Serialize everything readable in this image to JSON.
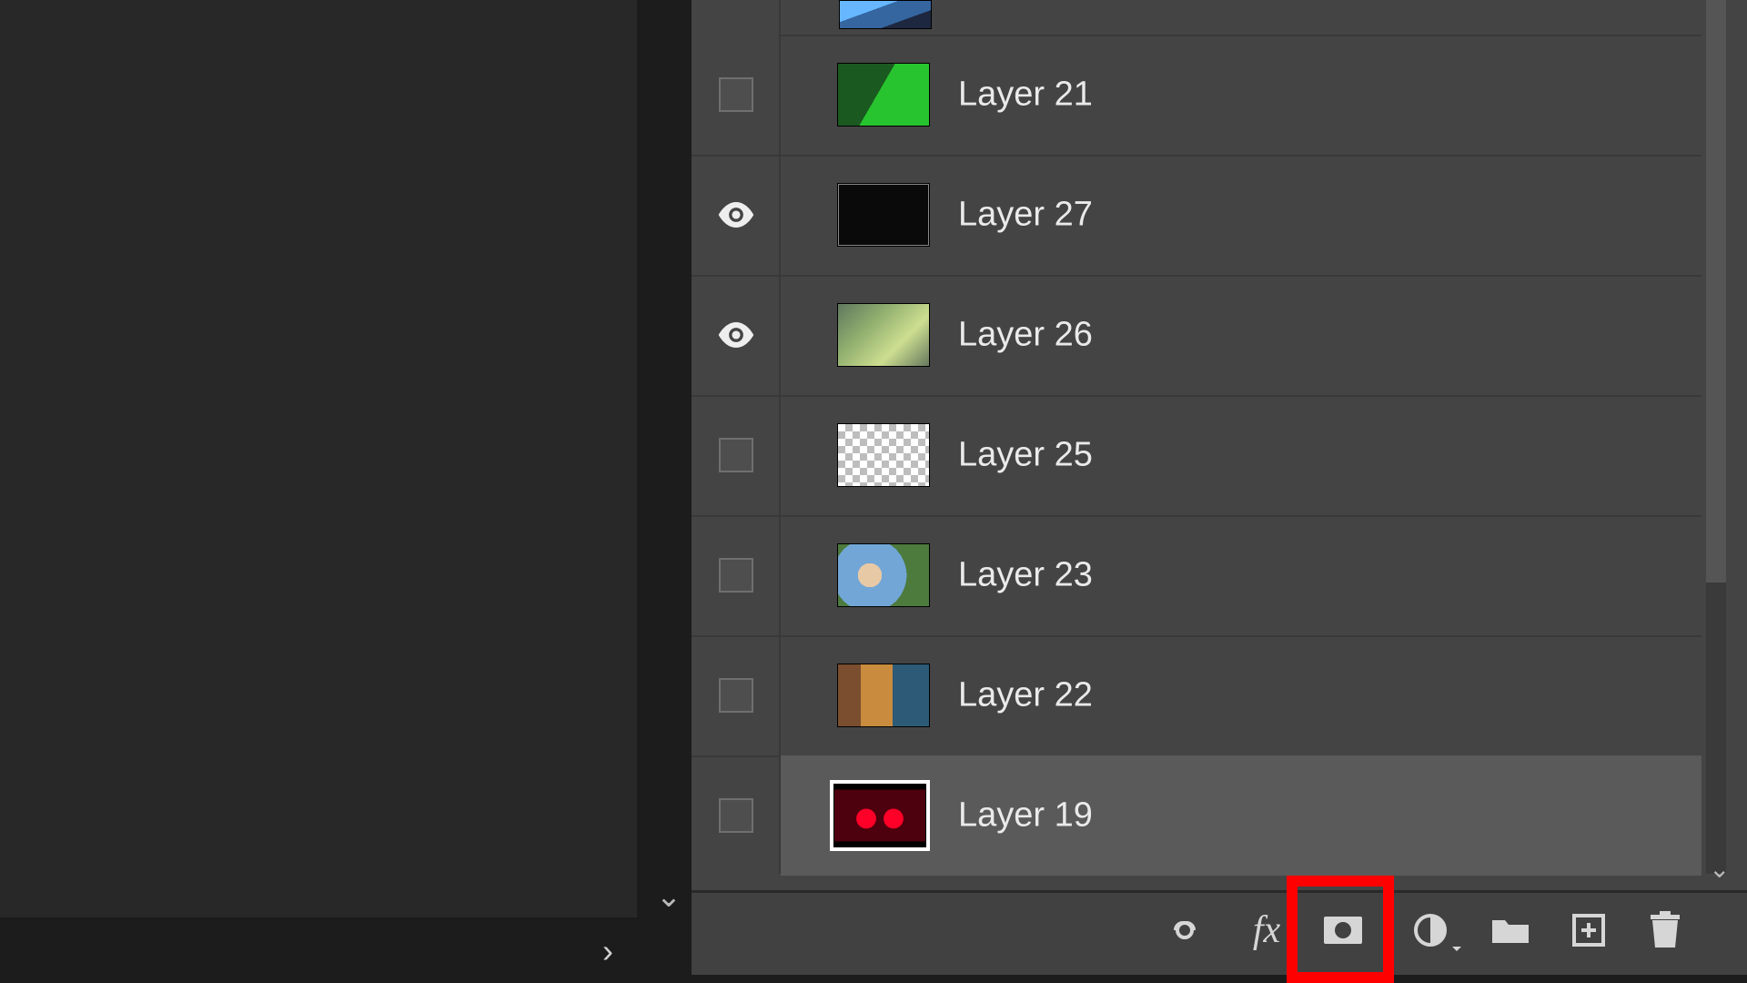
{
  "layers": [
    {
      "id": "top",
      "name": "",
      "visible": null,
      "thumb": "thumb-top",
      "partial": true,
      "selected": false
    },
    {
      "id": "l21",
      "name": "Layer 21",
      "visible": false,
      "thumb": "thumb-green",
      "partial": false,
      "selected": false
    },
    {
      "id": "l27",
      "name": "Layer 27",
      "visible": true,
      "thumb": "thumb-dark",
      "partial": false,
      "selected": false
    },
    {
      "id": "l26",
      "name": "Layer 26",
      "visible": true,
      "thumb": "thumb-jungle",
      "partial": false,
      "selected": false
    },
    {
      "id": "l25",
      "name": "Layer 25",
      "visible": false,
      "thumb": "thumb-checker",
      "partial": false,
      "selected": false
    },
    {
      "id": "l23",
      "name": "Layer 23",
      "visible": false,
      "thumb": "thumb-hand",
      "partial": false,
      "selected": false
    },
    {
      "id": "l22",
      "name": "Layer 22",
      "visible": false,
      "thumb": "thumb-shop",
      "partial": false,
      "selected": false
    },
    {
      "id": "l19",
      "name": "Layer 19",
      "visible": false,
      "thumb": "thumb-red",
      "partial": false,
      "selected": true
    }
  ],
  "toolbar": {
    "link": "Link layers",
    "fx": "Add layer style",
    "mask": "Add layer mask",
    "adjustment": "Create fill/adjustment layer",
    "group": "Create new group",
    "new_layer": "Create new layer",
    "delete": "Delete layer"
  },
  "callout": {
    "target": "mask"
  }
}
